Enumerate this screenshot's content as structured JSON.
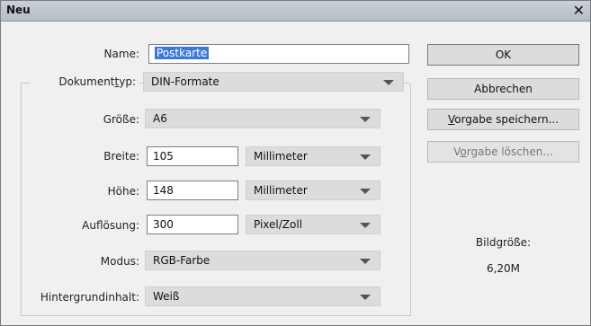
{
  "window": {
    "title": "Neu"
  },
  "fields": {
    "name": {
      "label": "Name:",
      "value": "Postkarte"
    },
    "documenttype": {
      "label_pre": "Dokument",
      "label_ul": "t",
      "label_post": "yp:",
      "value": "DIN-Formate"
    },
    "size": {
      "label": "Größe:",
      "value": "A6"
    },
    "width": {
      "label": "Breite:",
      "value": "105",
      "unit": "Millimeter"
    },
    "height": {
      "label": "Höhe:",
      "value": "148",
      "unit": "Millimeter"
    },
    "resolution": {
      "label": "Auflösung:",
      "value": "300",
      "unit": "Pixel/Zoll"
    },
    "mode": {
      "label": "Modus:",
      "value": "RGB-Farbe"
    },
    "background": {
      "label": "Hintergrundinhalt:",
      "value": "Weiß"
    }
  },
  "buttons": {
    "ok": "OK",
    "cancel": "Abbrechen",
    "save_preset_ul": "V",
    "save_preset_rest": "orgabe speichern...",
    "delete_preset_pre": "V",
    "delete_preset_ul": "o",
    "delete_preset_rest": "rgabe löschen..."
  },
  "image_size": {
    "label": "Bildgröße:",
    "value": "6,20M"
  }
}
